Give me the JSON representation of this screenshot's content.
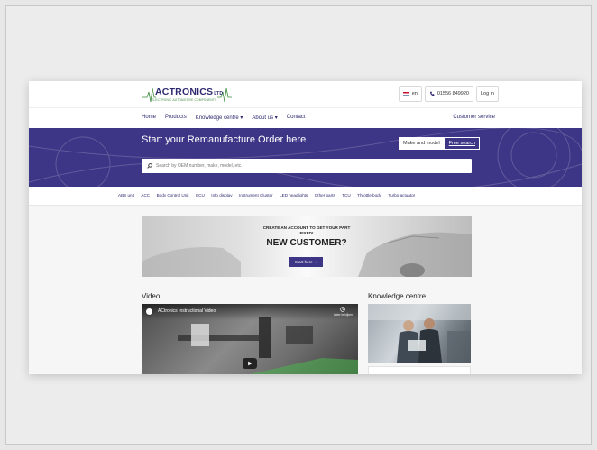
{
  "brand": {
    "name": "ACTRONICS",
    "suffix": "LTD",
    "tagline": "ELECTRONIC AUTOMOTIVE COMPONENTS"
  },
  "header": {
    "language": "en",
    "phone": "01556 849920",
    "login": "Log in"
  },
  "nav": {
    "items": [
      "Home",
      "Products",
      "Knowledge centre ▾",
      "About us ▾",
      "Contact"
    ],
    "right": "Customer service"
  },
  "hero": {
    "title": "Start your Remanufacture Order here",
    "toggle_a": "Make and model",
    "toggle_b": "Free search",
    "search_placeholder": "Search by OEM number, make, model, etc."
  },
  "categories": [
    "ABS unit",
    "ACC",
    "Body Control Unit",
    "ECU",
    "Info display",
    "Instrument Cluster",
    "LED headlights",
    "Other parts",
    "TCU",
    "Throttle body",
    "Turbo actuator"
  ],
  "banner": {
    "subtitle": "CREATE AN ACCOUNT TO GET YOUR PART FIXED!",
    "title": "NEW CUSTOMER?",
    "button": "Start here"
  },
  "sections": {
    "video": "Video",
    "knowledge": "Knowledge centre"
  },
  "video": {
    "title": "ACtronics Instructional Video",
    "later": "Later bekijken"
  },
  "colors": {
    "brand_purple": "#3d3585",
    "brand_green": "#3b8a3b"
  }
}
